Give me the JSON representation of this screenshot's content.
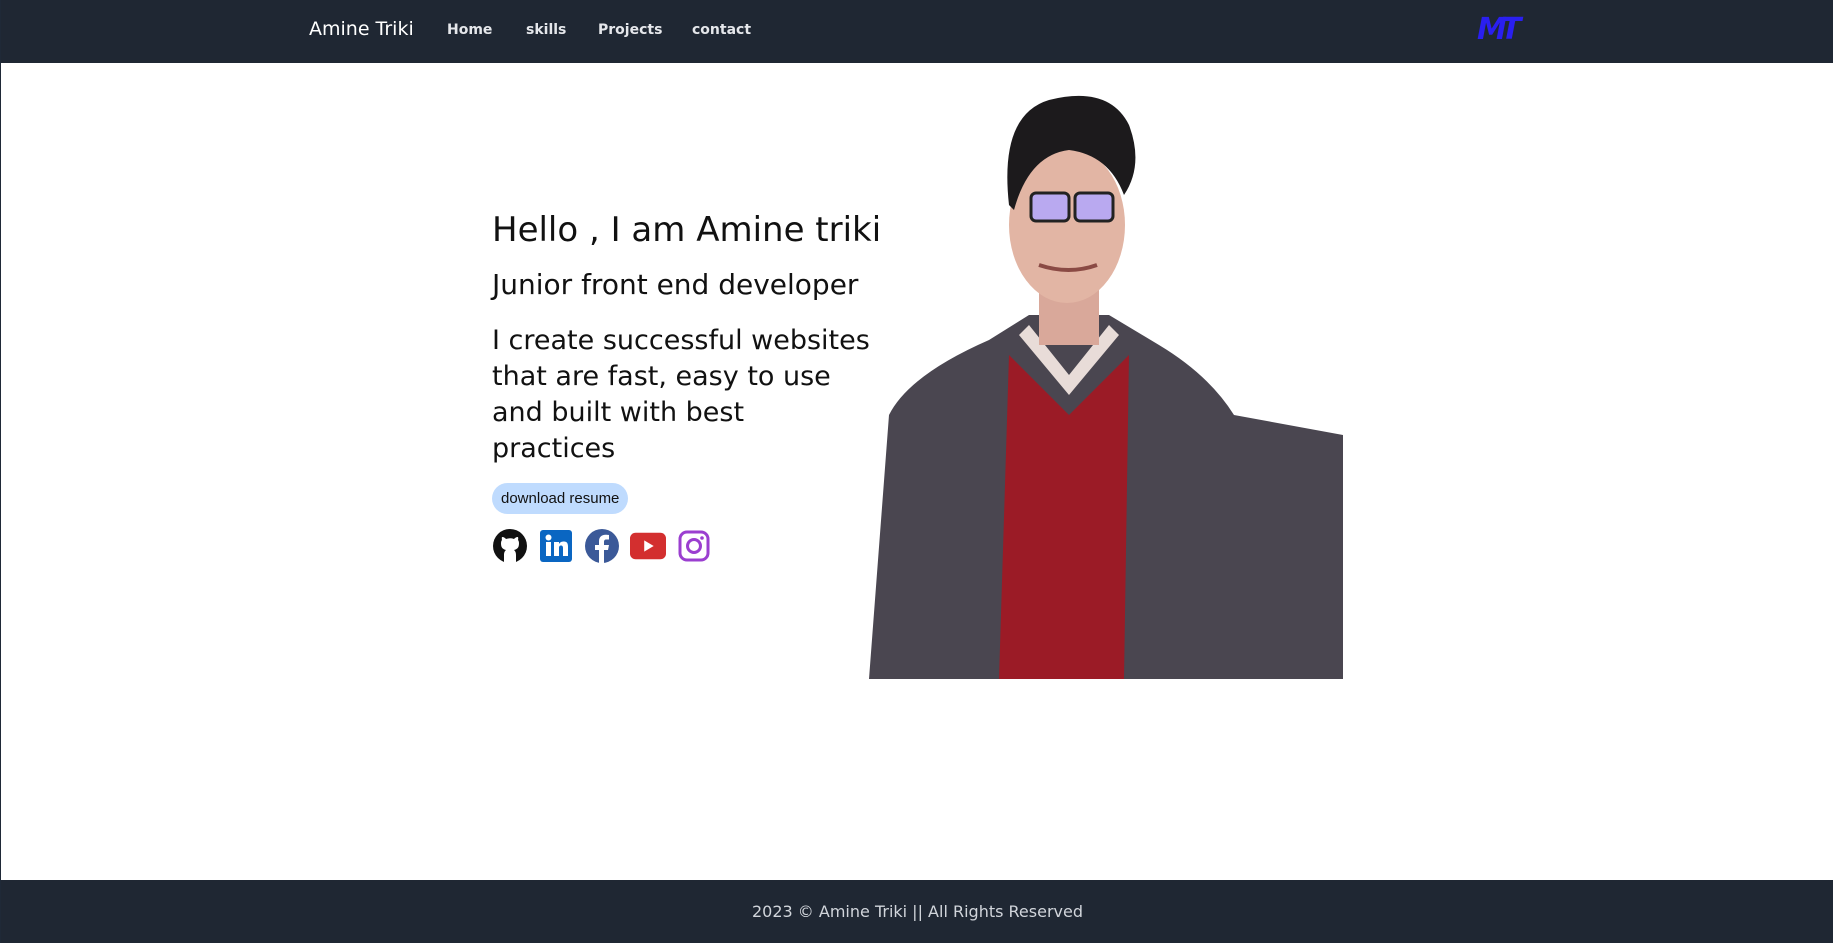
{
  "nav": {
    "brand": "Amine Triki",
    "items": [
      "Home",
      "skills",
      "Projects",
      "contact"
    ],
    "logo": "MT"
  },
  "hero": {
    "title": "Hello , I am Amine triki",
    "subtitle": "Junior front end developer",
    "tagline": "I create successful websites that are fast, easy to use and built with best practices",
    "button": "download resume",
    "social": [
      "github",
      "linkedin",
      "facebook",
      "youtube",
      "instagram"
    ]
  },
  "footer": {
    "text": "2023 © Amine Triki || All Rights Reserved"
  },
  "colors": {
    "nav_bg": "#1f2733",
    "button_bg": "#bfdbfe",
    "logo": "#2a1ff0"
  }
}
